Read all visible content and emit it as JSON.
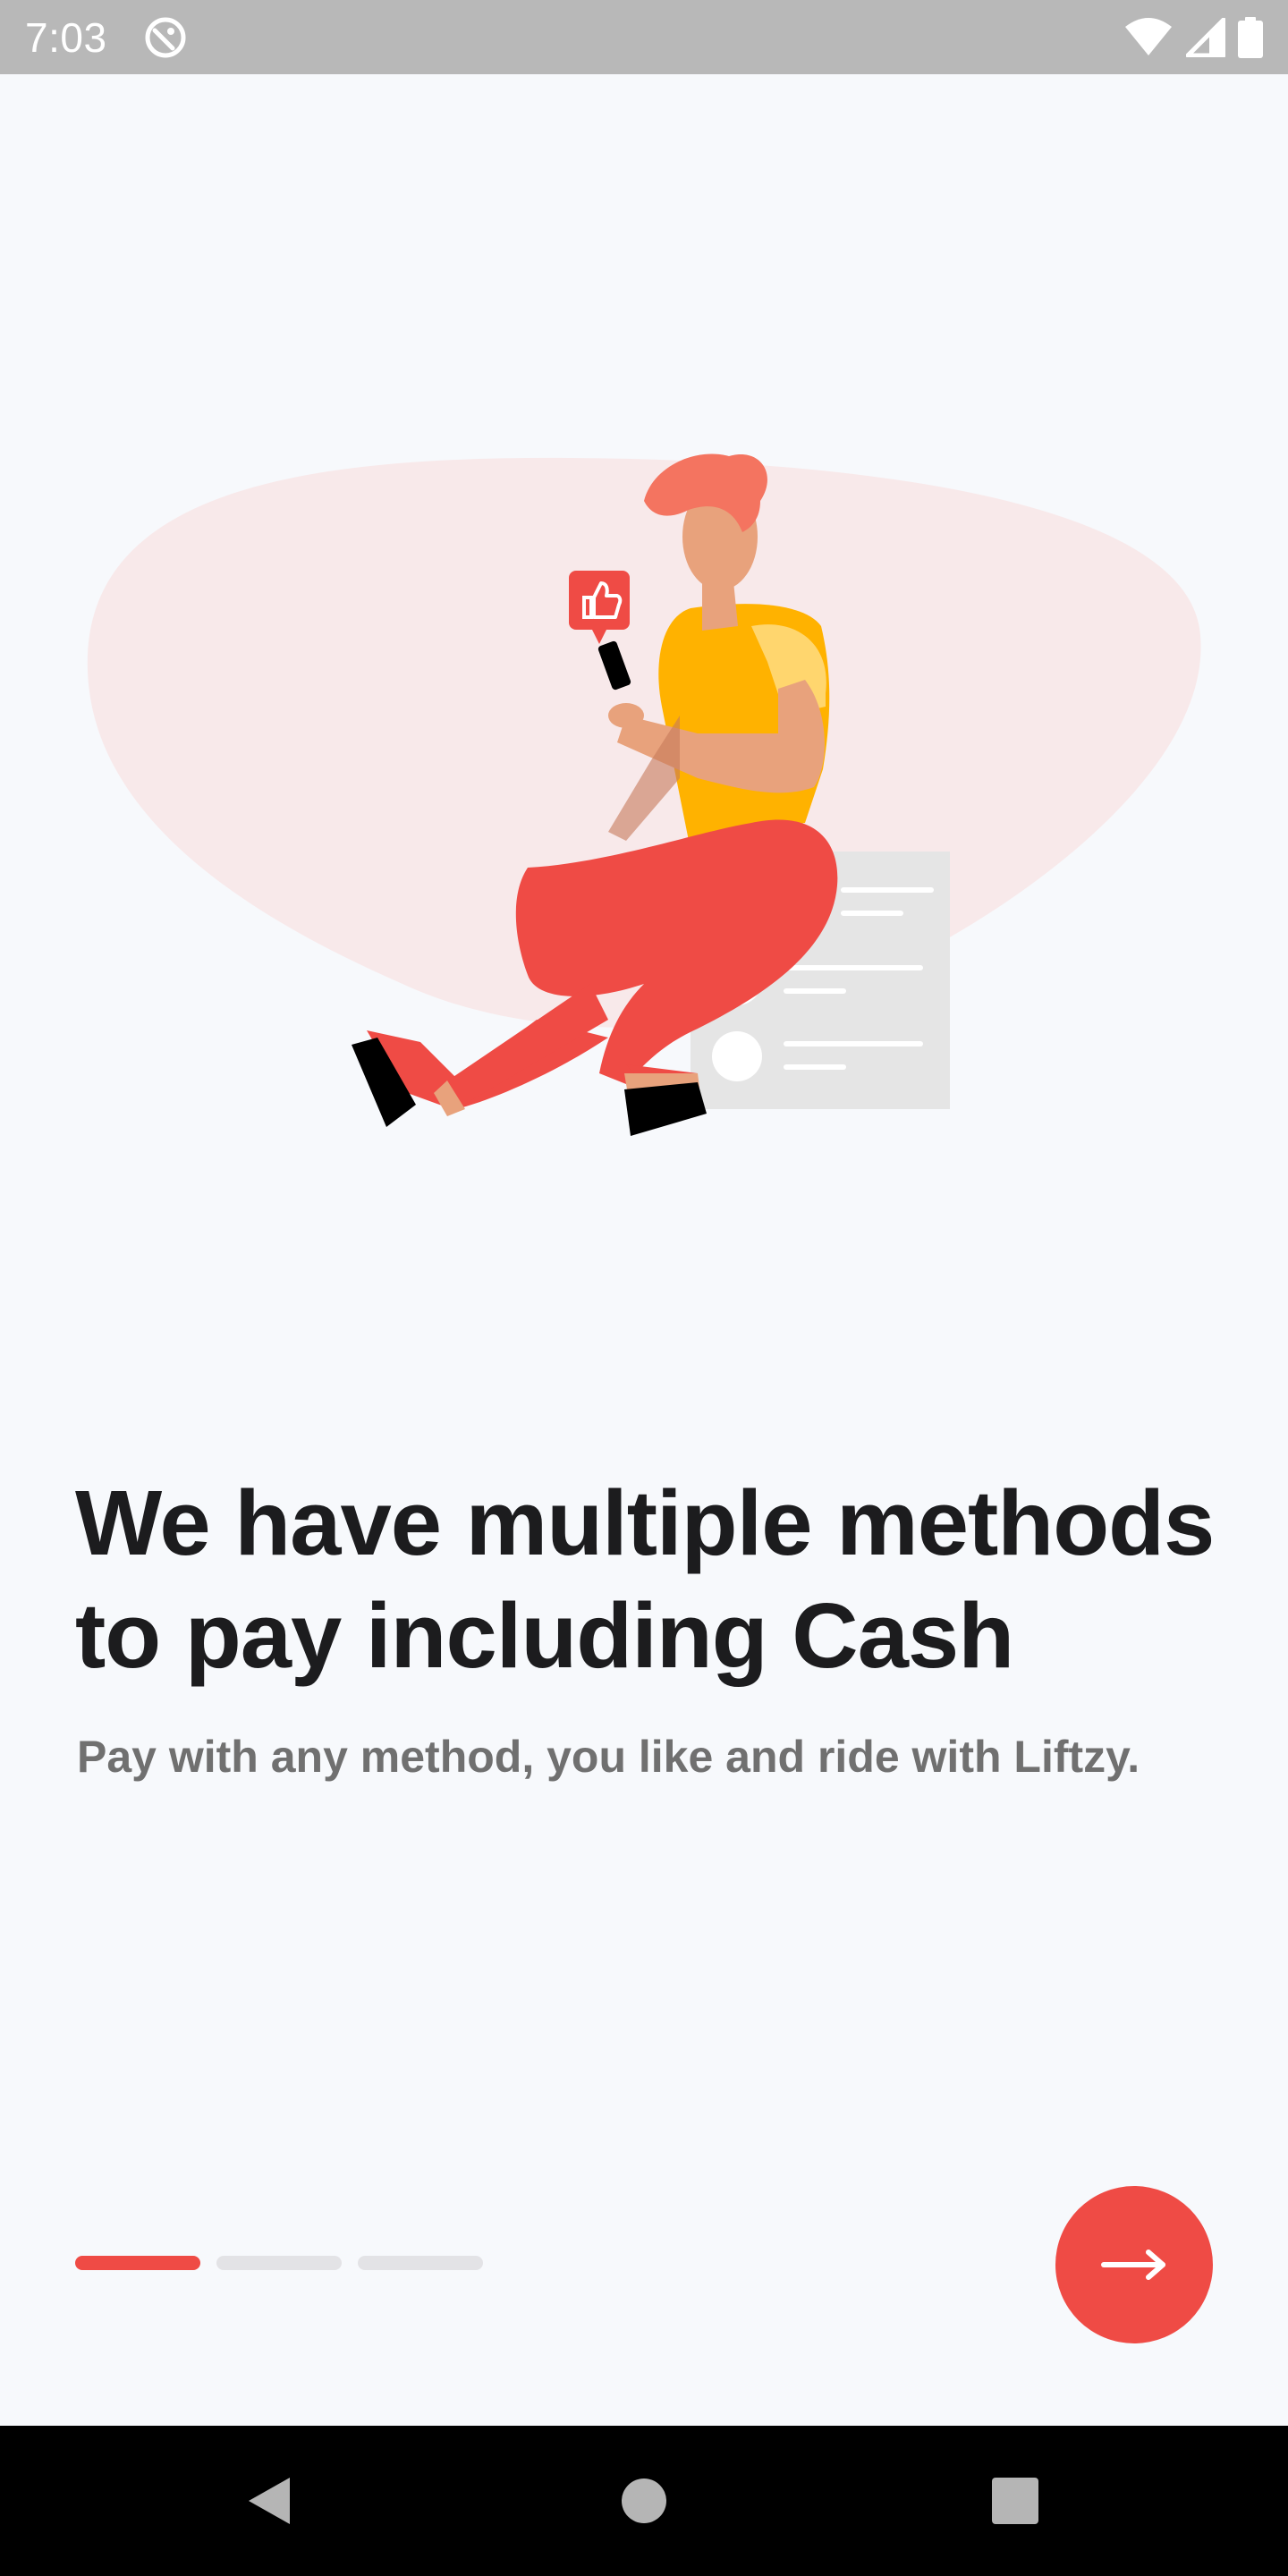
{
  "status_bar": {
    "time": "7:03",
    "icons": [
      "notification-icon",
      "wifi-icon",
      "signal-icon",
      "battery-icon"
    ]
  },
  "onboarding": {
    "headline": "We have multiple methods to pay including Cash",
    "subtitle": "Pay with any method, you like and ride with Liftzy.",
    "page_index": 0,
    "page_count": 3,
    "next_icon": "arrow-right-icon"
  },
  "nav_bar": {
    "icons": [
      "back-icon",
      "home-icon",
      "recents-icon"
    ]
  },
  "colors": {
    "accent": "#ef4b45",
    "background": "#f7f9fc",
    "headline": "#1c1c1e",
    "subtitle": "#707070",
    "indicator_inactive": "#e3e3e6"
  }
}
